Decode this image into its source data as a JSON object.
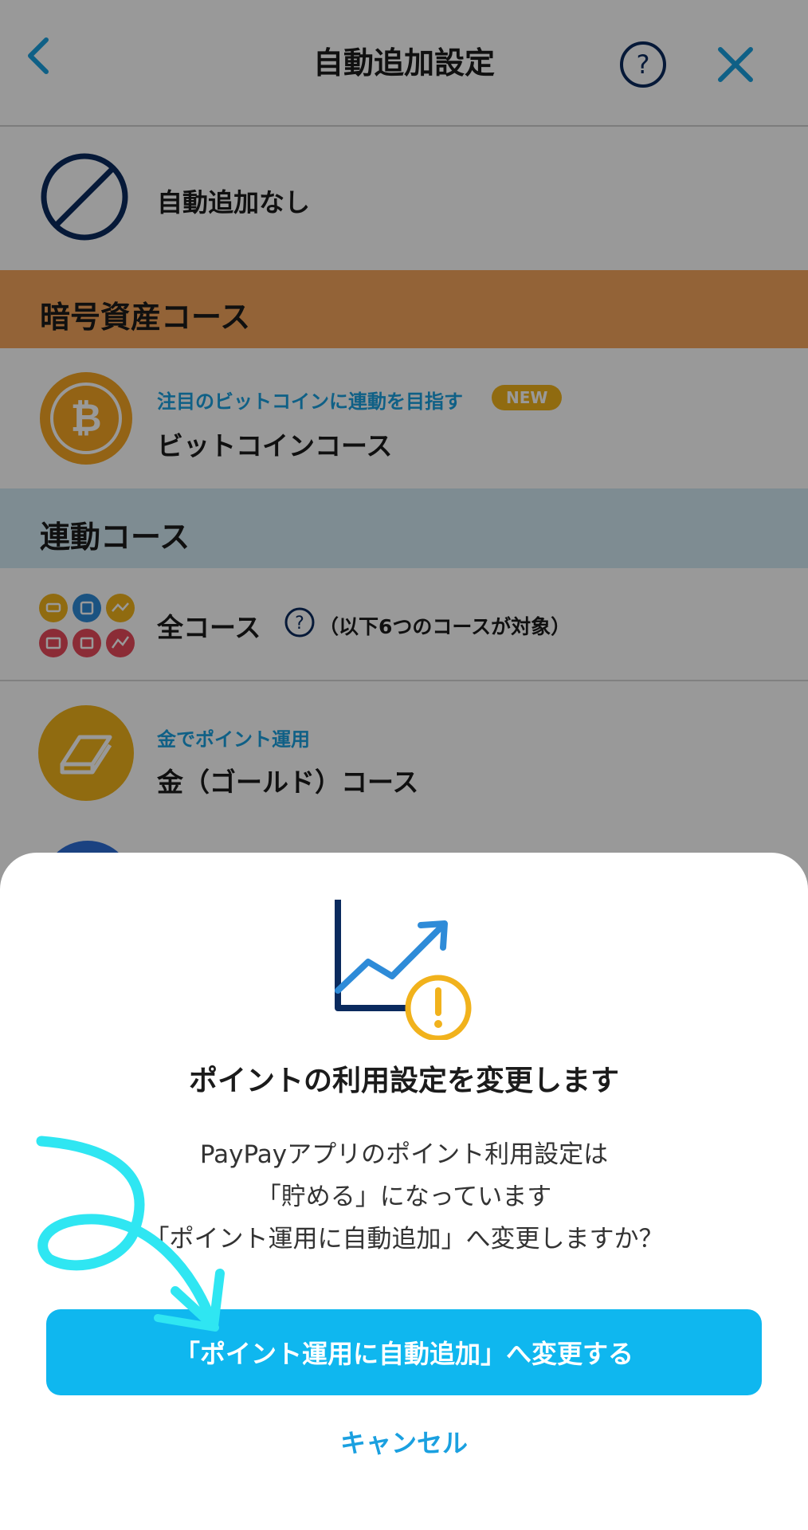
{
  "header": {
    "title": "自動追加設定"
  },
  "no_auto": {
    "label": "自動追加なし"
  },
  "section_crypto": {
    "label": "暗号資産コース",
    "color": "#f5a55c"
  },
  "bitcoin": {
    "sub": "注目のビットコインに連動を目指す",
    "badge": "NEW",
    "title": "ビットコインコース"
  },
  "section_link": {
    "label": "連動コース",
    "color": "#d3eaf3"
  },
  "all_course": {
    "title": "全コース",
    "note": "（以下6つのコースが対象）"
  },
  "gold": {
    "sub": "金でポイント運用",
    "title": "金（ゴールド）コース"
  },
  "dialog": {
    "title": "ポイントの利用設定を変更します",
    "body_lines": [
      "PayPayアプリのポイント利用設定は",
      "「貯める」になっています",
      "「ポイント運用に自動追加」へ変更しますか？"
    ],
    "confirm_label": "「ポイント運用に自動追加」へ変更する",
    "cancel_label": "キャンセル"
  },
  "colors": {
    "accent": "#0fb7ef",
    "link": "#1aa0e0",
    "navy": "#0a2a5e",
    "gold": "#f1b21c",
    "annotation": "#2fe6f2"
  }
}
